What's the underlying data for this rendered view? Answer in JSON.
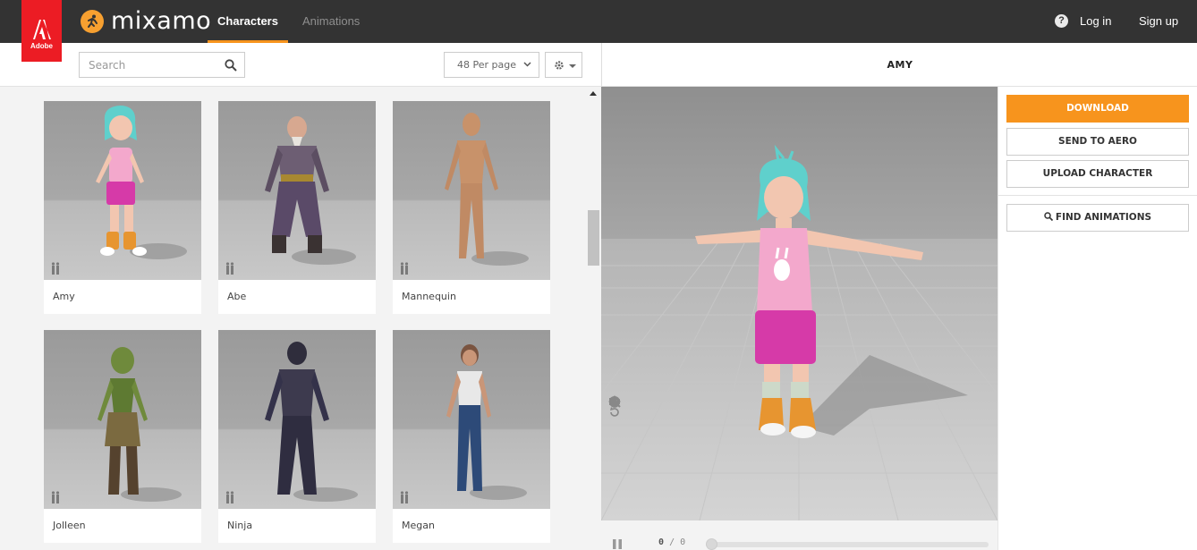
{
  "header": {
    "brand_text": "mixamo",
    "adobe_label": "Adobe",
    "tabs": [
      {
        "label": "Characters",
        "active": true
      },
      {
        "label": "Animations",
        "active": false
      }
    ],
    "login_label": "Log in",
    "signup_label": "Sign up",
    "accent_color": "#f7941d"
  },
  "toolbar": {
    "search_placeholder": "Search",
    "per_page_label": "48 Per page"
  },
  "characters": [
    {
      "name": "Amy",
      "selected": true
    },
    {
      "name": "Abe",
      "selected": false
    },
    {
      "name": "Mannequin",
      "selected": false
    },
    {
      "name": "Jolleen",
      "selected": false
    },
    {
      "name": "Ninja",
      "selected": false
    },
    {
      "name": "Megan",
      "selected": false
    }
  ],
  "viewer": {
    "character_title": "AMY",
    "frame_current": "0",
    "frame_total": "0",
    "frame_separator": "/"
  },
  "actions": {
    "download_label": "DOWNLOAD",
    "send_label": "SEND TO AERO",
    "upload_label": "UPLOAD CHARACTER",
    "find_label": "FIND ANIMATIONS"
  },
  "icons": [
    "adobe-logo",
    "mixamo-logo-icon",
    "help-icon",
    "search-icon",
    "chevron-down-icon",
    "gear-icon",
    "skeleton-icon",
    "reset-icon",
    "pan-icon",
    "zoom-icon",
    "timer-icon",
    "camera-icon",
    "pause-icon"
  ]
}
